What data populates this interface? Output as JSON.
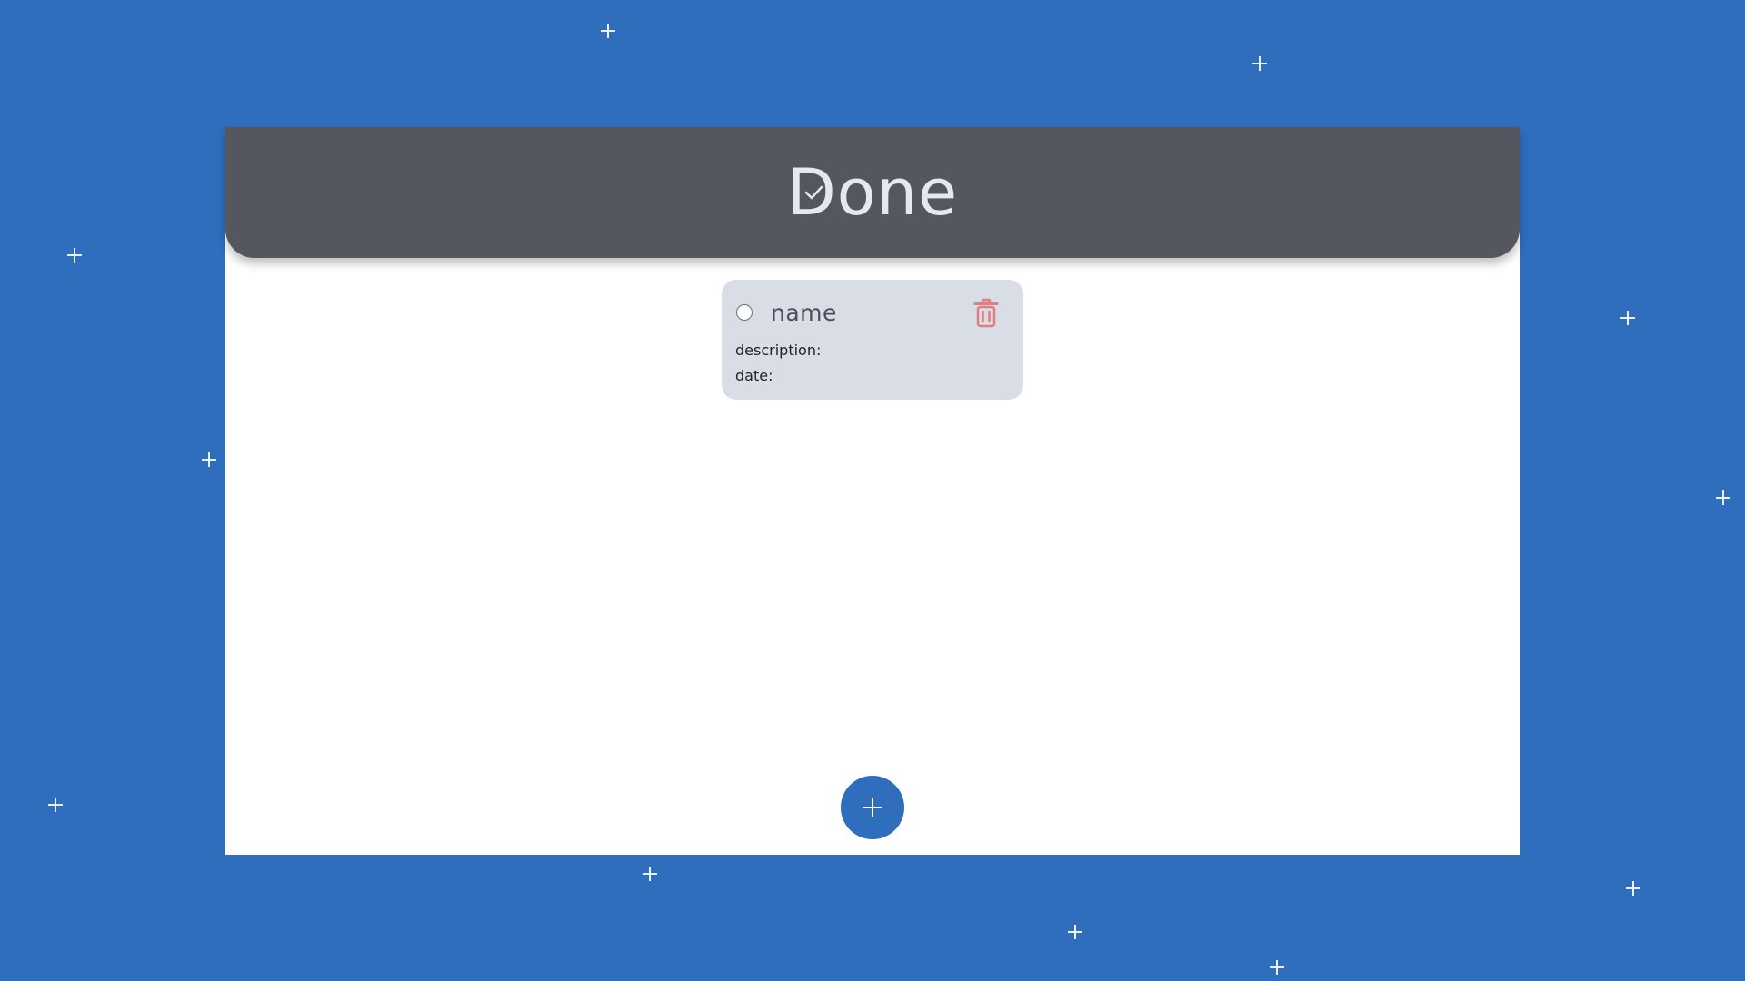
{
  "colors": {
    "background": "#2f6dbd",
    "header": "#545660",
    "card": "#d9dde6",
    "delete_icon": "#e07f7f",
    "add_button": "#2f6dbd"
  },
  "header": {
    "title": "Done",
    "icon": "checkmark-icon"
  },
  "task": {
    "name": "name",
    "description_label": "description:",
    "date_label": "date:",
    "complete_control": "radio",
    "delete_icon": "trash-icon"
  },
  "add_button": {
    "icon": "plus-icon"
  },
  "decorations": {
    "icon": "sparkle-icon"
  }
}
